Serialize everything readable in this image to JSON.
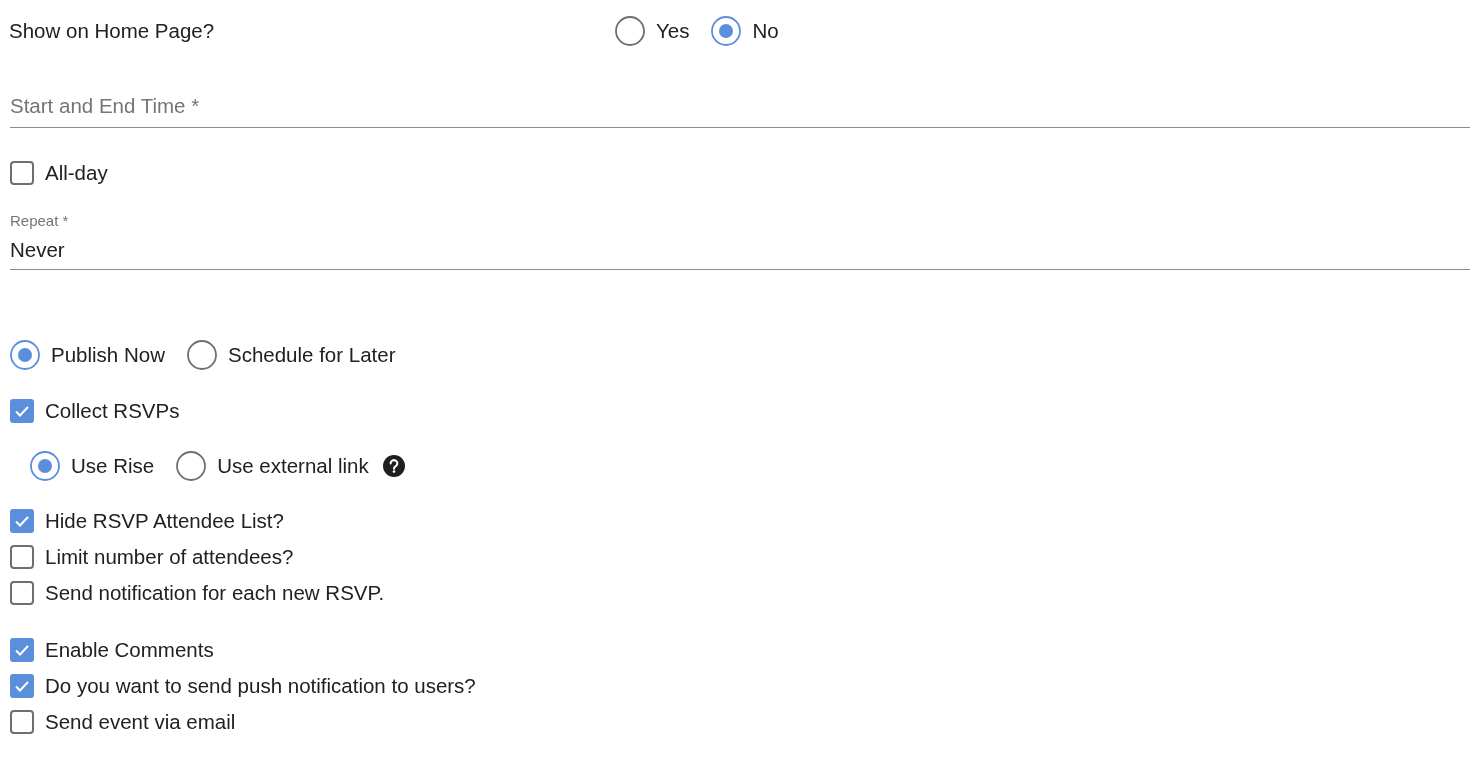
{
  "show_on_home_page": {
    "label": "Show on Home Page?",
    "options": [
      {
        "label": "Yes",
        "selected": false
      },
      {
        "label": "No",
        "selected": true
      }
    ]
  },
  "start_end_time": {
    "placeholder": "Start and End Time *"
  },
  "all_day": {
    "label": "All-day",
    "checked": false
  },
  "repeat": {
    "label": "Repeat *",
    "value": "Never"
  },
  "publish": {
    "options": [
      {
        "label": "Publish Now",
        "selected": true
      },
      {
        "label": "Schedule for Later",
        "selected": false
      }
    ]
  },
  "collect_rsvps": {
    "label": "Collect RSVPs",
    "checked": true
  },
  "rsvp_method": {
    "options": [
      {
        "label": "Use Rise",
        "selected": true
      },
      {
        "label": "Use external link",
        "selected": false
      }
    ]
  },
  "rsvp_options": [
    {
      "label": "Hide RSVP Attendee List?",
      "checked": true
    },
    {
      "label": "Limit number of attendees?",
      "checked": false
    },
    {
      "label": "Send notification for each new RSVP.",
      "checked": false
    }
  ],
  "event_options": [
    {
      "label": "Enable Comments",
      "checked": true
    },
    {
      "label": "Do you want to send push notification to users?",
      "checked": true
    },
    {
      "label": "Send event via email",
      "checked": false
    }
  ]
}
